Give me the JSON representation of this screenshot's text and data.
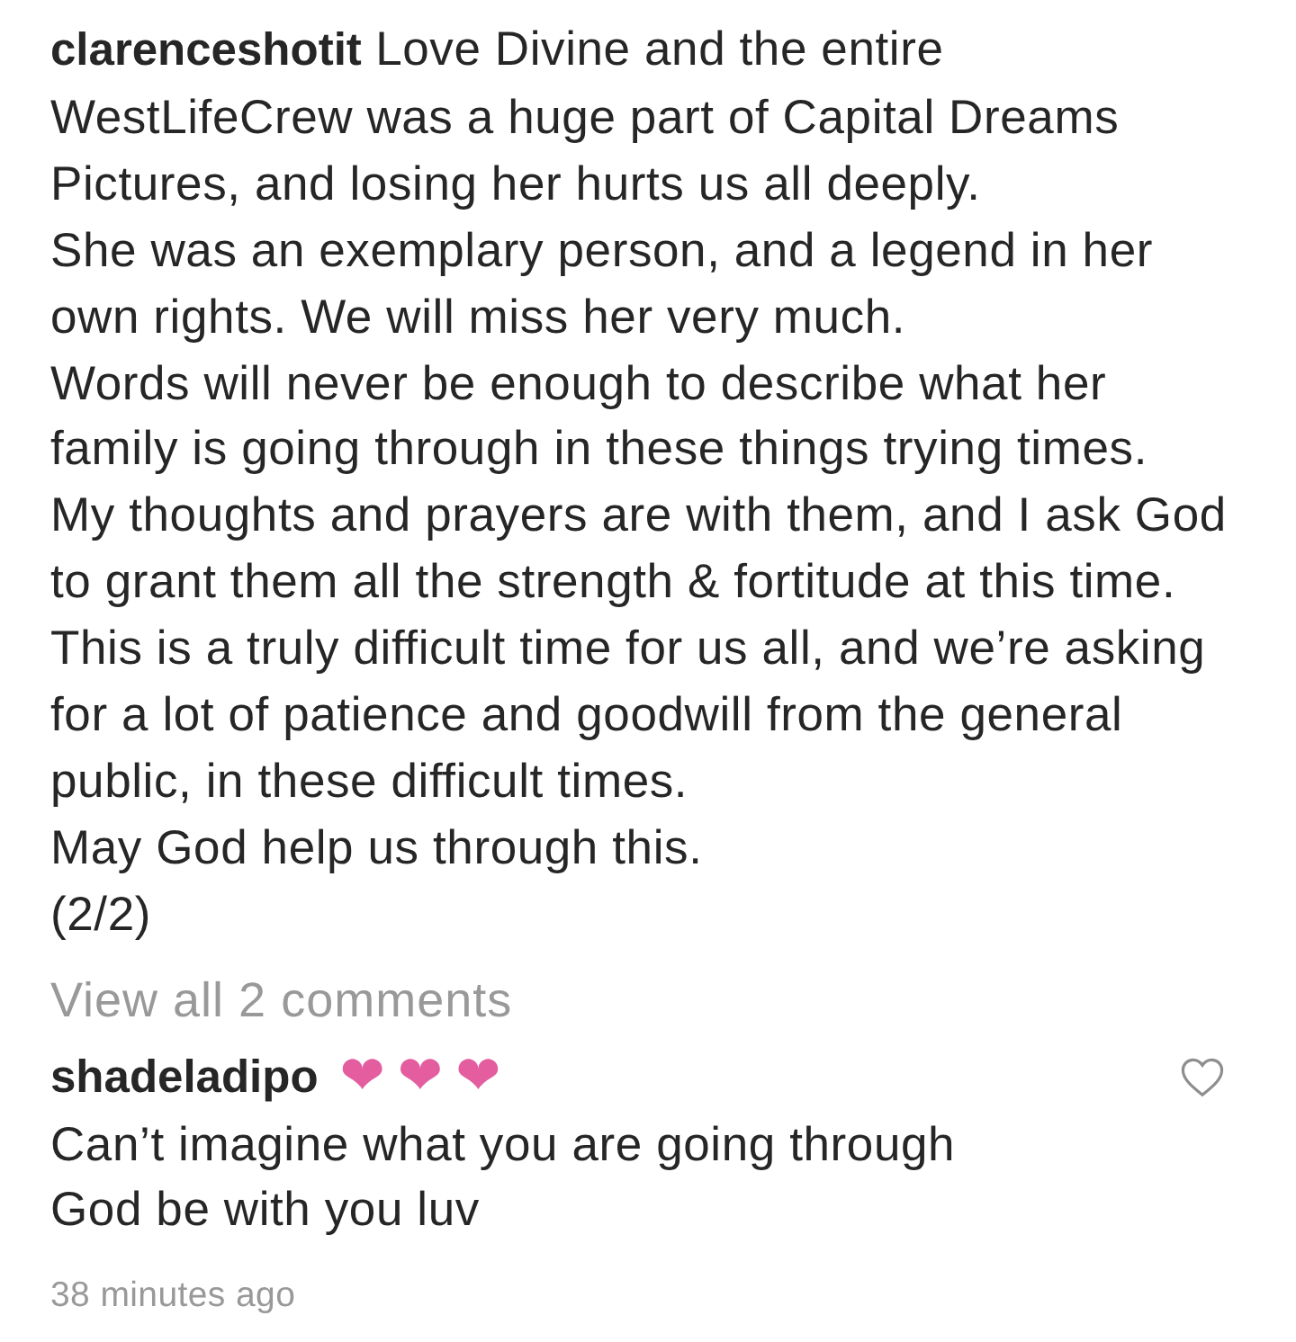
{
  "caption": {
    "username": "clarenceshotit",
    "lines": [
      "Love Divine and the entire",
      "WestLifeCrew was a huge part of Capital Dreams",
      "Pictures, and losing her hurts us all deeply.",
      "She was an exemplary person, and a legend in her",
      "own rights. We will miss her very much.",
      "Words will never be enough to describe what her",
      "family is going through in these things trying times.",
      "My thoughts and prayers are with them, and I ask God",
      "to grant them all the strength & fortitude at this time.",
      "This is a truly difficult time for us all, and we’re asking",
      "for a lot of patience and goodwill from the general",
      "public, in these difficult times.",
      "May God help us through this.",
      "(2/2)"
    ]
  },
  "view_all": "View all 2 comments",
  "comment": {
    "username": "shadeladipo",
    "emoji": [
      "❤",
      "❤",
      "❤"
    ],
    "liked": false,
    "lines": [
      "Can’t imagine what you are going through",
      "God be with you luv"
    ],
    "time": "38 minutes ago"
  }
}
